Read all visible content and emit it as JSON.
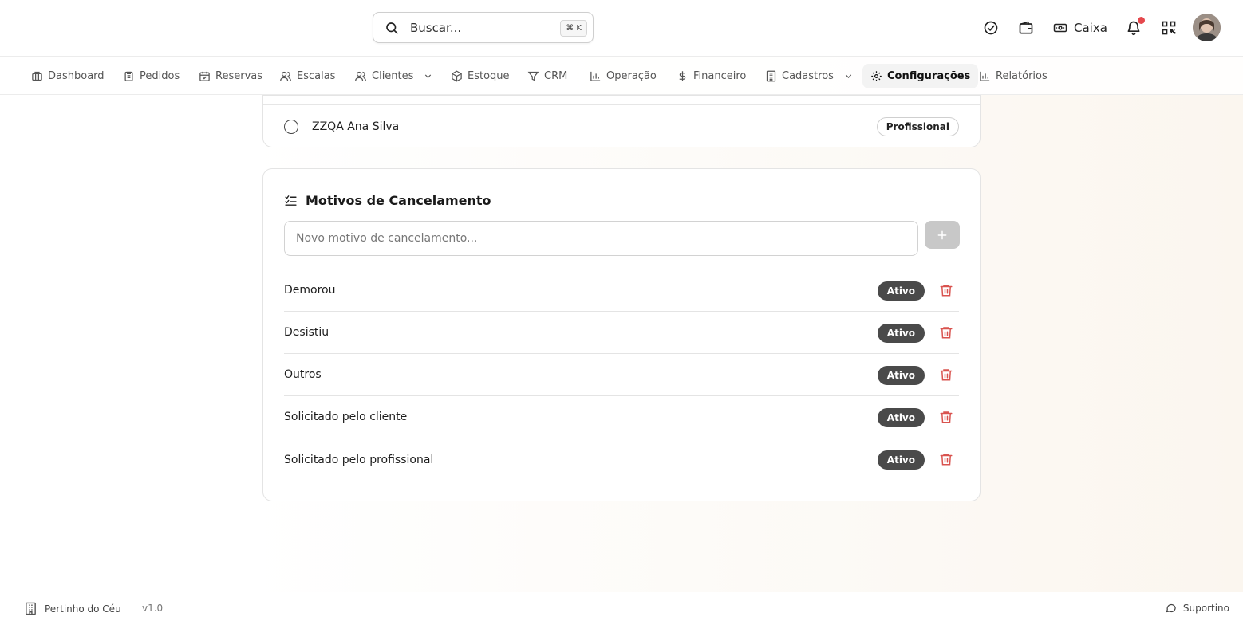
{
  "header": {
    "search_placeholder": "Buscar...",
    "search_shortcut": "⌘ K",
    "caixa_label": "Caixa",
    "icons": [
      "check-circle-icon",
      "wallet-icon",
      "cash-icon",
      "bell-icon",
      "qr-code-icon"
    ],
    "has_notification": true
  },
  "nav": {
    "items": [
      {
        "label": "Dashboard",
        "icon": "dashboard-icon"
      },
      {
        "label": "Pedidos",
        "icon": "clipboard-icon"
      },
      {
        "label": "Reservas",
        "icon": "calendar-check-icon"
      },
      {
        "label": "Escalas",
        "icon": "users-icon"
      },
      {
        "label": "Clientes",
        "icon": "users-icon",
        "has_dropdown": true
      },
      {
        "label": "Estoque",
        "icon": "package-icon"
      },
      {
        "label": "CRM",
        "icon": "funnel-icon"
      },
      {
        "label": "Operação",
        "icon": "bar-chart-icon"
      },
      {
        "label": "Financeiro",
        "icon": "dollar-icon"
      },
      {
        "label": "Cadastros",
        "icon": "building-icon",
        "has_dropdown": true
      },
      {
        "label": "Configurações",
        "icon": "gear-icon",
        "active": true
      },
      {
        "label": "Relatórios",
        "icon": "bar-chart-icon"
      }
    ]
  },
  "professional": {
    "name": "ZZQA Ana Silva",
    "badge": "Profissional"
  },
  "cancel_reasons": {
    "title": "Motivos de Cancelamento",
    "input_placeholder": "Novo motivo de cancelamento...",
    "items": [
      {
        "label": "Demorou",
        "status": "Ativo"
      },
      {
        "label": "Desistiu",
        "status": "Ativo"
      },
      {
        "label": "Outros",
        "status": "Ativo"
      },
      {
        "label": "Solicitado pelo cliente",
        "status": "Ativo"
      },
      {
        "label": "Solicitado pelo profissional",
        "status": "Ativo"
      }
    ]
  },
  "footer": {
    "brand": "Pertinho do Céu",
    "version": "v1.0",
    "support": "Suportino"
  },
  "colors": {
    "accent_dark": "#4a4a4a",
    "danger": "#d9534f",
    "notification": "#e5484d"
  }
}
